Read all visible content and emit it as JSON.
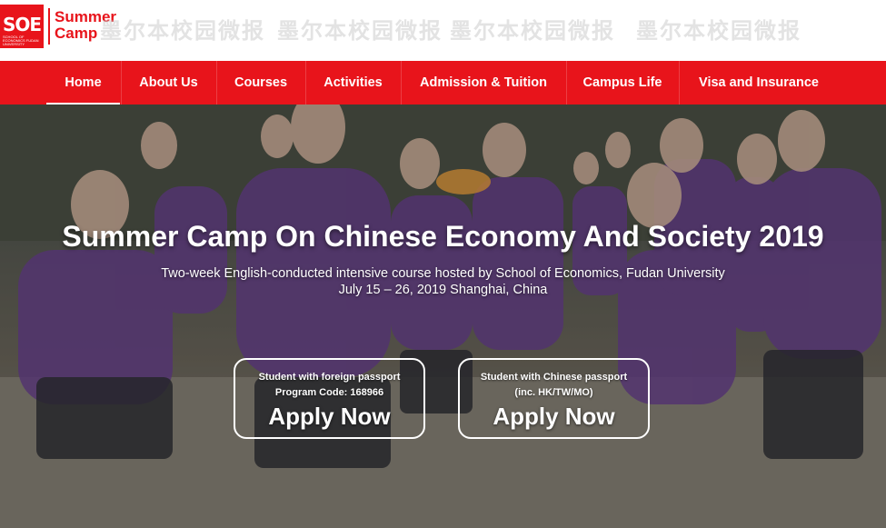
{
  "header": {
    "logo_mark": "SOE",
    "logo_subtext": "SCHOOL OF ECONOMICS FUDAN UNIVERSITY",
    "logo_text_line1": "Summer",
    "logo_text_line2": "Camp",
    "watermark": "墨尔本校园微报",
    "brand_color": "#e8141b"
  },
  "nav": {
    "items": [
      {
        "label": "Home",
        "active": true
      },
      {
        "label": "About Us"
      },
      {
        "label": "Courses"
      },
      {
        "label": "Activities"
      },
      {
        "label": "Admission & Tuition"
      },
      {
        "label": "Campus Life"
      },
      {
        "label": "Visa and Insurance"
      }
    ]
  },
  "hero": {
    "title": "Summer Camp On Chinese Economy And Society 2019",
    "subtitle": "Two-week English-conducted intensive course hosted by School of Economics, Fudan University",
    "dates": "July 15 – 26, 2019 Shanghai, China",
    "buttons": [
      {
        "line1": "Student with foreign passport",
        "line2": "Program Code: 168966",
        "cta": "Apply Now"
      },
      {
        "line1": "Student with Chinese passport",
        "line2": "(inc. HK/TW/MO)",
        "cta": "Apply Now"
      }
    ]
  }
}
